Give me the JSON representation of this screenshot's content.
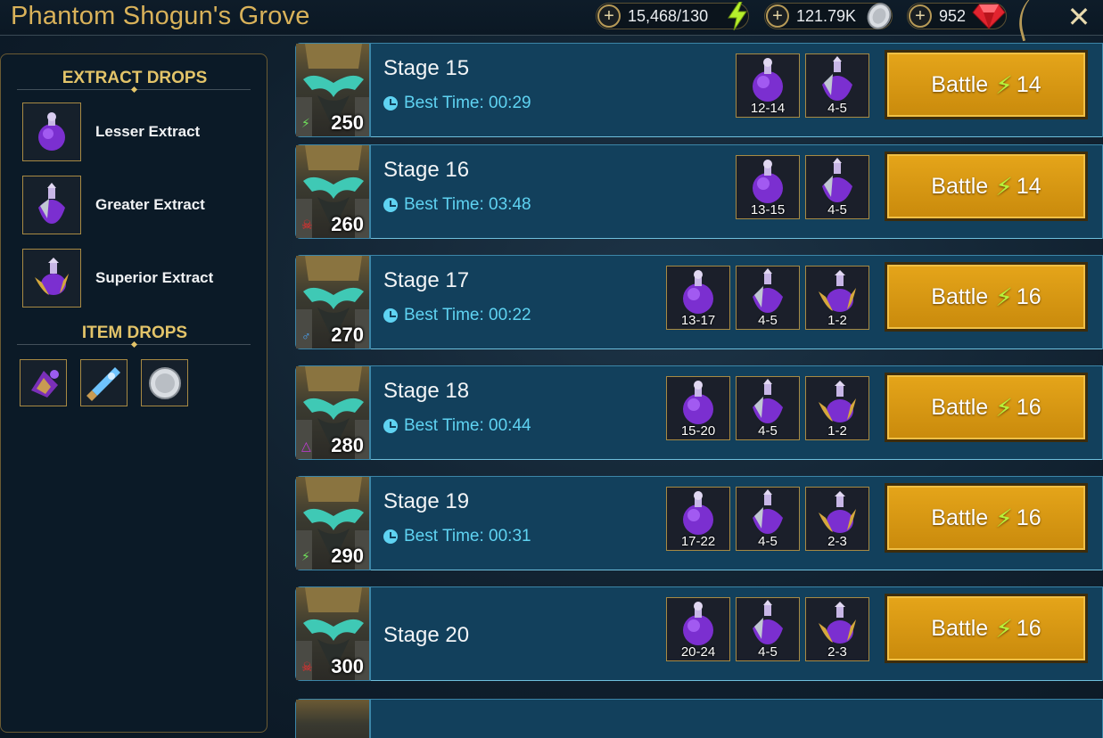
{
  "header": {
    "title": "Phantom Shogun's Grove",
    "energy": "15,468/130",
    "silver": "121.79K",
    "gems": "952"
  },
  "left_panel": {
    "extract_title": "EXTRACT DROPS",
    "extracts": [
      {
        "label": "Lesser Extract"
      },
      {
        "label": "Greater Extract"
      },
      {
        "label": "Superior Extract"
      }
    ],
    "item_title": "ITEM DROPS"
  },
  "stages": [
    {
      "name": "Stage 15",
      "best": "Best Time: 00:29",
      "level": "250",
      "drops": [
        "12-14",
        "4-5"
      ],
      "battle": "Battle",
      "energy": "14"
    },
    {
      "name": "Stage 16",
      "best": "Best Time: 03:48",
      "level": "260",
      "drops": [
        "13-15",
        "4-5"
      ],
      "battle": "Battle",
      "energy": "14"
    },
    {
      "name": "Stage 17",
      "best": "Best Time: 00:22",
      "level": "270",
      "drops": [
        "13-17",
        "4-5",
        "1-2"
      ],
      "battle": "Battle",
      "energy": "16"
    },
    {
      "name": "Stage 18",
      "best": "Best Time: 00:44",
      "level": "280",
      "drops": [
        "15-20",
        "4-5",
        "1-2"
      ],
      "battle": "Battle",
      "energy": "16"
    },
    {
      "name": "Stage 19",
      "best": "Best Time: 00:31",
      "level": "290",
      "drops": [
        "17-22",
        "4-5",
        "2-3"
      ],
      "battle": "Battle",
      "energy": "16"
    },
    {
      "name": "Stage 20",
      "best": "",
      "level": "300",
      "drops": [
        "20-24",
        "4-5",
        "2-3"
      ],
      "battle": "Battle",
      "energy": "16"
    }
  ],
  "colors": {
    "gold": "#d9b25a",
    "accent_cyan": "#5fd3f2",
    "battle_gold": "#e5a51a",
    "row_blue": "#12405c"
  }
}
